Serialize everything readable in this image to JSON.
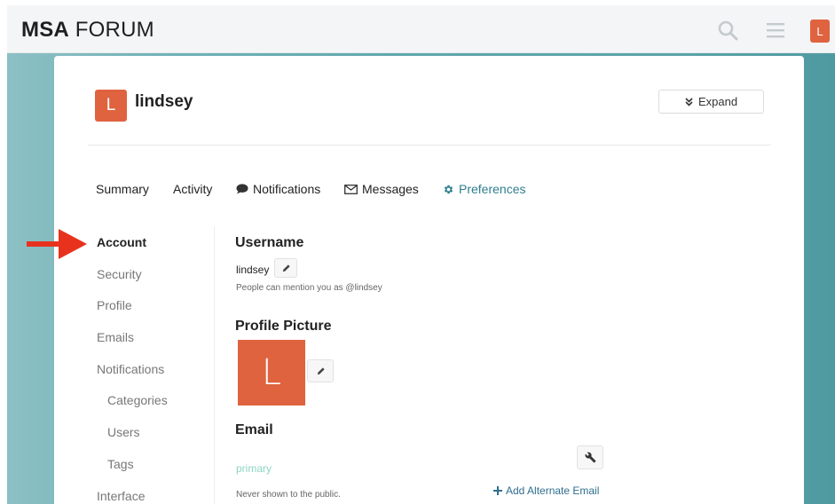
{
  "header": {
    "logo_bold": "MSA",
    "logo_light": " FORUM",
    "avatar_letter": "L"
  },
  "user": {
    "avatar_letter": "L",
    "name": "lindsey",
    "expand_label": "Expand"
  },
  "tabs": [
    {
      "label": "Summary",
      "icon": ""
    },
    {
      "label": "Activity",
      "icon": ""
    },
    {
      "label": "Notifications",
      "icon": "speech-bubble-icon"
    },
    {
      "label": "Messages",
      "icon": "envelope-icon"
    },
    {
      "label": "Preferences",
      "icon": "gear-icon",
      "active": true
    }
  ],
  "nav": {
    "items": [
      "Account",
      "Security",
      "Profile",
      "Emails",
      "Notifications",
      "Categories",
      "Users",
      "Tags",
      "Interface"
    ]
  },
  "account": {
    "username_title": "Username",
    "username_value": "lindsey",
    "username_hint": "People can mention you as @lindsey",
    "picture_title": "Profile Picture",
    "picture_letter": "L",
    "email_title": "Email",
    "email_primary": "primary",
    "email_hint": "Never shown to the public.",
    "add_email": "Add Alternate Email"
  },
  "colors": {
    "accent": "#2f7e8e",
    "avatar": "#e0633f",
    "arrow": "#e8321e",
    "primary_label": "#8ed6c2"
  }
}
